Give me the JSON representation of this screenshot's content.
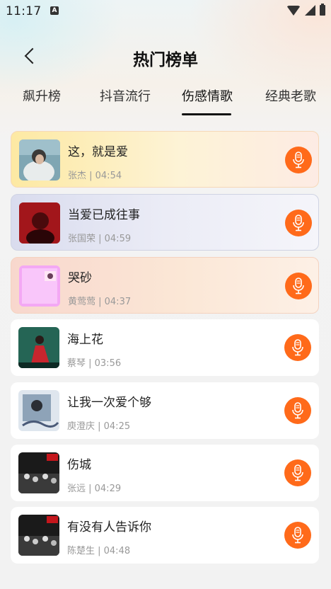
{
  "status_bar": {
    "time": "11:17",
    "notification_icon": "A"
  },
  "header": {
    "title": "热门榜单",
    "back_icon": "chevron-left-icon"
  },
  "tabs": [
    {
      "label": "飙升榜",
      "active": false
    },
    {
      "label": "抖音流行",
      "active": false
    },
    {
      "label": "伤感情歌",
      "active": true
    },
    {
      "label": "经典老歌",
      "active": false
    }
  ],
  "songs": [
    {
      "title": "这，就是爱",
      "meta": "张杰 | 04:54",
      "highlight": "rank1"
    },
    {
      "title": "当爱已成往事",
      "meta": "张国荣 | 04:59",
      "highlight": "rank2"
    },
    {
      "title": "哭砂",
      "meta": "黄莺莺 | 04:37",
      "highlight": "rank3"
    },
    {
      "title": "海上花",
      "meta": "蔡琴 | 03:56",
      "highlight": ""
    },
    {
      "title": "让我一次爱个够",
      "meta": "庾澄庆 | 04:25",
      "highlight": ""
    },
    {
      "title": "伤城",
      "meta": "张远 | 04:29",
      "highlight": ""
    },
    {
      "title": "有没有人告诉你",
      "meta": "陈楚生 | 04:48",
      "highlight": ""
    }
  ],
  "action_icon": "microphone-icon",
  "colors": {
    "accent": "#ff6a1a",
    "active_tab": "#111111"
  }
}
